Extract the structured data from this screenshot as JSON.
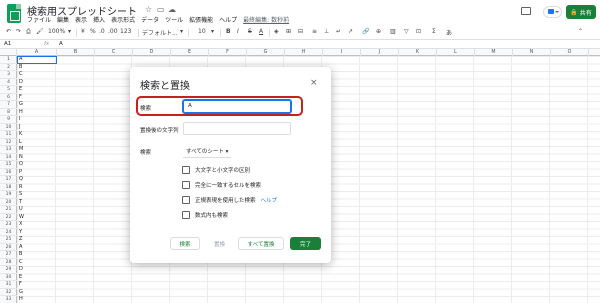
{
  "header": {
    "title": "検索用スプレッドシート",
    "share_label": "共有",
    "last_edit": "最終編集: 数秒前"
  },
  "menu": [
    "ファイル",
    "編集",
    "表示",
    "挿入",
    "表示形式",
    "データ",
    "ツール",
    "拡張機能",
    "ヘルプ"
  ],
  "toolbar": {
    "zoom": "100%",
    "currency": "¥",
    "percent": "%",
    "decimals": ".0",
    ".00": ".00",
    "number_format": "123",
    "font": "デフォルト...",
    "font_size": "10",
    "bold": "B",
    "italic": "I",
    "strike": "S",
    "text_color": "A"
  },
  "formula_bar": {
    "name_box": "A1",
    "fx": "fx",
    "value": "A"
  },
  "grid": {
    "columns": [
      "A",
      "B",
      "C",
      "D",
      "E",
      "F",
      "G",
      "H",
      "I",
      "J",
      "K",
      "L",
      "M",
      "N",
      "O"
    ],
    "column_a": [
      "A",
      "B",
      "C",
      "D",
      "E",
      "F",
      "G",
      "H",
      "I",
      "J",
      "K",
      "L",
      "M",
      "N",
      "O",
      "P",
      "Q",
      "R",
      "S",
      "T",
      "U",
      "W",
      "X",
      "Y",
      "Z",
      "A",
      "B",
      "C",
      "D",
      "E",
      "F",
      "G",
      "H"
    ]
  },
  "dialog": {
    "title": "検索と置換",
    "close": "×",
    "find_label": "検索",
    "find_value": "A",
    "replace_label": "置換後の文字列",
    "replace_value": "",
    "scope_label": "検索",
    "scope_value": "すべてのシート",
    "options": [
      {
        "label": "大文字と小文字の区別",
        "checked": false
      },
      {
        "label": "完全に一致するセルを検索",
        "checked": false
      },
      {
        "label": "正規表現を使用した検索",
        "checked": false
      },
      {
        "label": "数式内も検索",
        "checked": false
      }
    ],
    "help": "ヘルプ",
    "buttons": {
      "find": "検索",
      "replace": "置換",
      "replace_all": "すべて置換",
      "done": "完了"
    }
  },
  "colors": {
    "accent": "#188038",
    "highlight": "#c5221f",
    "selection": "#1a73e8"
  }
}
